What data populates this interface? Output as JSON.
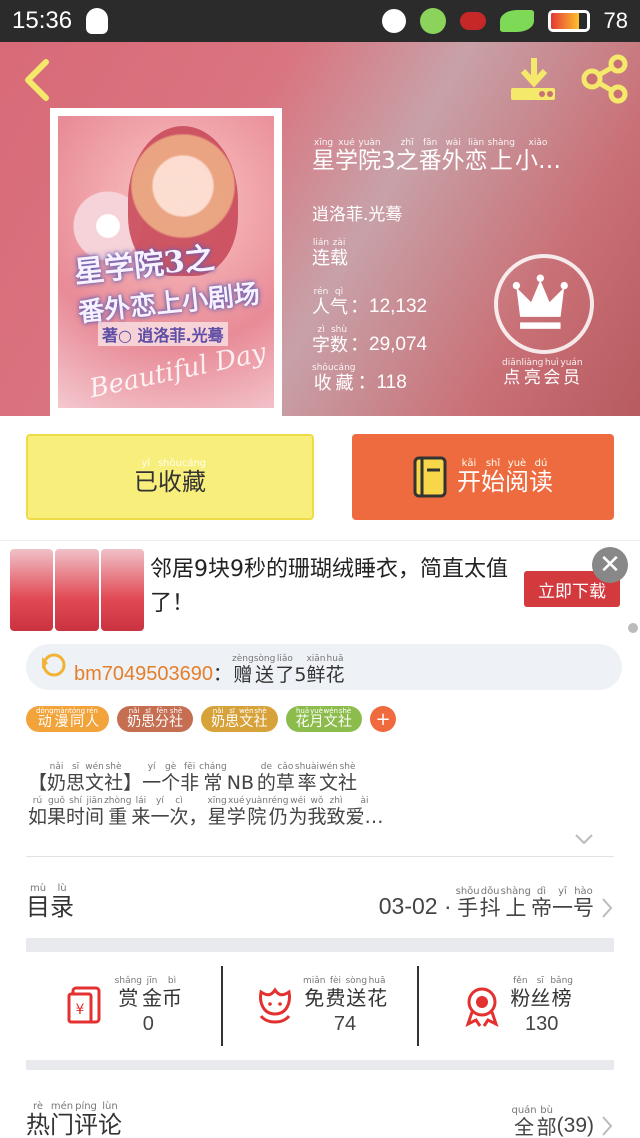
{
  "status_bar": {
    "time": "15:36",
    "battery_pct": "78",
    "battery_level": 0.78,
    "network": "4G"
  },
  "book": {
    "cover": {
      "title_line1": "星学院3之",
      "title_line2": "番外恋上小剧场",
      "author": "著○ 逍洛菲.光蓦",
      "script": "Beautiful Day"
    },
    "title": {
      "pinyin": [
        "xīng",
        "xué",
        "yuàn",
        "",
        "zhī",
        "fān",
        "wài",
        "liàn",
        "shàng",
        "xiǎo"
      ],
      "chars": [
        "星",
        "学",
        "院",
        "3",
        "之",
        "番",
        "外",
        "恋",
        "上",
        "小…"
      ]
    },
    "author": "逍洛菲.光蓦",
    "status": {
      "pinyin": [
        "lián",
        "zài"
      ],
      "chars": [
        "连",
        "载"
      ]
    },
    "popularity": {
      "pinyin": [
        "rén",
        "qì"
      ],
      "chars": [
        "人",
        "气"
      ],
      "value": "：12,132"
    },
    "word_count": {
      "pinyin": [
        "zì",
        "shù"
      ],
      "chars": [
        "字",
        "数"
      ],
      "value": "：29,074"
    },
    "favorites": {
      "pinyin": [
        "shōu",
        "cáng"
      ],
      "chars": [
        "收",
        "藏"
      ],
      "value": "：118"
    }
  },
  "member": {
    "pinyin": [
      "diǎn",
      "liàng",
      "huì",
      "yuán"
    ],
    "chars": [
      "点",
      "亮",
      "会",
      "员"
    ]
  },
  "buttons": {
    "favorited": {
      "pinyin": [
        "yǐ",
        "shōu",
        "cáng"
      ],
      "chars": [
        "已",
        "收",
        "藏"
      ]
    },
    "read": {
      "pinyin": [
        "kāi",
        "shǐ",
        "yuè",
        "dú"
      ],
      "chars": [
        "开",
        "始",
        "阅",
        "读"
      ]
    }
  },
  "ad": {
    "text": "邻居9块9秒的珊瑚绒睡衣，简直太值了！",
    "cta": "立即下载",
    "close": "✕"
  },
  "gift": {
    "user": "bm7049503690",
    "sep": "：",
    "pinyin": [
      "zèng",
      "sòng",
      "liǎo",
      "",
      "xiān",
      "huā"
    ],
    "chars": [
      "赠",
      "送",
      "了",
      "5",
      "鲜",
      "花"
    ]
  },
  "tags": [
    {
      "pinyin": [
        "dòng",
        "màn",
        "tóng",
        "rén"
      ],
      "chars": [
        "动",
        "漫",
        "同",
        "人"
      ],
      "color": "#f2a33a"
    },
    {
      "pinyin": [
        "nǎi",
        "sī",
        "fēn",
        "shè"
      ],
      "chars": [
        "奶",
        "思",
        "分",
        "社"
      ],
      "color": "#c56e52"
    },
    {
      "pinyin": [
        "nǎi",
        "sī",
        "wén",
        "shè"
      ],
      "chars": [
        "奶",
        "思",
        "文",
        "社"
      ],
      "color": "#d7a23a"
    },
    {
      "pinyin": [
        "huā",
        "yuè",
        "wén",
        "shè"
      ],
      "chars": [
        "花",
        "月",
        "文",
        "社"
      ],
      "color": "#8cbd4c"
    }
  ],
  "tag_add": "+",
  "description": {
    "line1": {
      "pinyin": [
        "",
        "nǎi",
        "sī",
        "wén",
        "shè",
        "",
        "yí",
        "gè",
        "fēi",
        "cháng",
        "",
        "",
        "",
        "de",
        "cǎo",
        "shuài",
        "wén",
        "shè"
      ],
      "chars": [
        "【",
        "奶",
        "思",
        "文",
        "社",
        "】",
        "一",
        "个",
        "非",
        "常",
        "N",
        "B",
        "",
        "的",
        "草",
        "率",
        "文",
        "社"
      ]
    },
    "line2": {
      "pinyin": [
        "rú",
        "guǒ",
        "shí",
        "jiān",
        "zhòng",
        "lái",
        "yí",
        "cì",
        "",
        "xīng",
        "xué",
        "yuàn",
        "réng",
        "wéi",
        "wǒ",
        "zhì",
        "ài"
      ],
      "chars": [
        "如",
        "果",
        "时",
        "间",
        "重",
        "来",
        "一",
        "次",
        "，",
        "星",
        "学",
        "院",
        "仍",
        "为",
        "我",
        "致",
        "爱…"
      ]
    }
  },
  "catalog": {
    "pinyin": [
      "mù",
      "lù"
    ],
    "chars": [
      "目",
      "录"
    ],
    "chapter_num": "03-02 ·",
    "chapter_pinyin": [
      "shǒu",
      "dǒu",
      "shàng",
      "dì",
      "yī",
      "hào"
    ],
    "chapter_chars": [
      "手",
      "抖",
      "上",
      "帝",
      "一",
      "号"
    ]
  },
  "stats": [
    {
      "pinyin": [
        "shǎng",
        "jīn",
        "bì"
      ],
      "chars": [
        "赏",
        "金",
        "币"
      ],
      "value": "0",
      "icon": "red-envelope-icon"
    },
    {
      "pinyin": [
        "miǎn",
        "fèi",
        "sòng",
        "huā"
      ],
      "chars": [
        "免",
        "费",
        "送",
        "花"
      ],
      "value": "74",
      "icon": "flower-icon"
    },
    {
      "pinyin": [
        "fěn",
        "sī",
        "bǎng"
      ],
      "chars": [
        "粉",
        "丝",
        "榜"
      ],
      "value": "130",
      "icon": "medal-icon"
    }
  ],
  "hot_comments": {
    "pinyin": [
      "rè",
      "mén",
      "píng",
      "lùn"
    ],
    "chars": [
      "热",
      "门",
      "评",
      "论"
    ],
    "all_pinyin": [
      "quán",
      "bù"
    ],
    "all_chars": [
      "全",
      "部"
    ],
    "count": "(39)"
  },
  "colors": {
    "accent_orange": "#ee6a3f",
    "fav_yellow": "#f8ee7c",
    "red": "#d23a3d",
    "hero_pink": "#d96a78"
  }
}
